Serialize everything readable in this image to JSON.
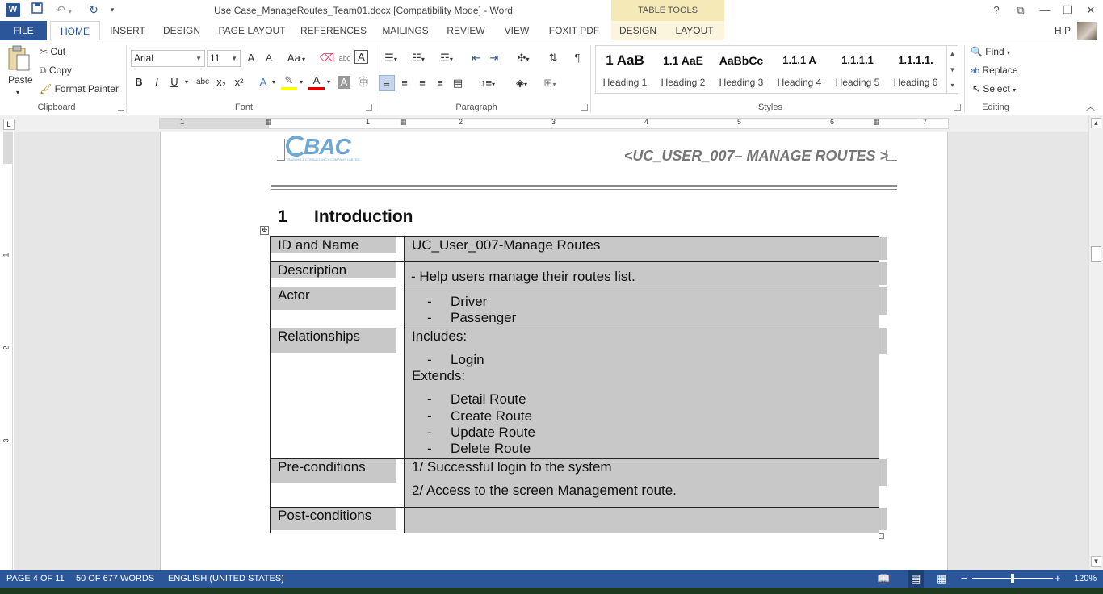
{
  "window": {
    "title": "Use Case_ManageRoutes_Team01.docx [Compatibility Mode] - Word",
    "table_tools_label": "TABLE TOOLS",
    "help_icon": "?",
    "user": "H P"
  },
  "tabs": [
    {
      "label": "FILE"
    },
    {
      "label": "HOME"
    },
    {
      "label": "INSERT"
    },
    {
      "label": "DESIGN"
    },
    {
      "label": "PAGE LAYOUT"
    },
    {
      "label": "REFERENCES"
    },
    {
      "label": "MAILINGS"
    },
    {
      "label": "REVIEW"
    },
    {
      "label": "VIEW"
    },
    {
      "label": "FOXIT PDF"
    },
    {
      "label": "DESIGN"
    },
    {
      "label": "LAYOUT"
    }
  ],
  "ribbon": {
    "clipboard": {
      "paste": "Paste",
      "cut": "Cut",
      "copy": "Copy",
      "format_painter": "Format Painter",
      "label": "Clipboard"
    },
    "font": {
      "family": "Arial",
      "size": "11",
      "label": "Font",
      "bold": "B",
      "italic": "I",
      "underline": "U",
      "strike": "abc",
      "sub": "x₂",
      "sup": "x²",
      "case": "Aa",
      "grow": "A",
      "shrink": "A",
      "effects": "A",
      "color": "A",
      "shading": "A",
      "enclose": "A"
    },
    "paragraph": {
      "label": "Paragraph",
      "pilcrow": "¶"
    },
    "styles": {
      "label": "Styles",
      "items": [
        {
          "sample": "1  AaB",
          "name": "Heading 1"
        },
        {
          "sample": "1.1  AaE",
          "name": "Heading 2"
        },
        {
          "sample": "AaBbCc",
          "name": "Heading 3"
        },
        {
          "sample": "1.1.1  A",
          "name": "Heading 4"
        },
        {
          "sample": "1.1.1.1",
          "name": "Heading 5"
        },
        {
          "sample": "1.1.1.1.",
          "name": "Heading 6"
        }
      ]
    },
    "editing": {
      "find": "Find",
      "replace": "Replace",
      "select": "Select",
      "label": "Editing"
    }
  },
  "ruler": {
    "h_numbers": [
      "1",
      "1",
      "2",
      "3",
      "4",
      "5",
      "6",
      "7"
    ],
    "v_numbers": [
      "1",
      "2",
      "3"
    ]
  },
  "document": {
    "logo_text": "BAC",
    "logo_subtext": "TRAINING & CONSULTANCY COMPANY LIMITED",
    "header_title": "<UC_USER_007– MANAGE ROUTES >",
    "heading_number": "1",
    "heading_text": "Introduction",
    "table": {
      "id_label": "ID and Name",
      "id_value": "UC_User_007-Manage Routes",
      "desc_label": "Description",
      "desc_value": "- Help users manage their routes list.",
      "actor_label": "Actor",
      "actors": [
        "Driver",
        "Passenger"
      ],
      "rel_label": "Relationships",
      "includes_label": "Includes:",
      "includes": [
        "Login"
      ],
      "extends_label": "Extends:",
      "extends": [
        "Detail Route",
        "Create Route",
        "Update Route",
        "Delete Route"
      ],
      "bullet": "-",
      "pre_label": "Pre-conditions",
      "pre_1": "1/ Successful login to the system",
      "pre_2": "2/ Access to the screen Management route.",
      "post_label": "Post-conditions",
      "post_value": ""
    }
  },
  "status": {
    "page": "PAGE 4 OF 11",
    "words": "50 OF 677 WORDS",
    "language": "ENGLISH (UNITED STATES)",
    "zoom": "120%",
    "zoom_minus": "−",
    "zoom_plus": "+"
  },
  "colors": {
    "accent": "#2b579a",
    "table_tools": "#f6e9b8",
    "cell_shading": "#c8c8c8",
    "logo": "#6fa8d6"
  }
}
